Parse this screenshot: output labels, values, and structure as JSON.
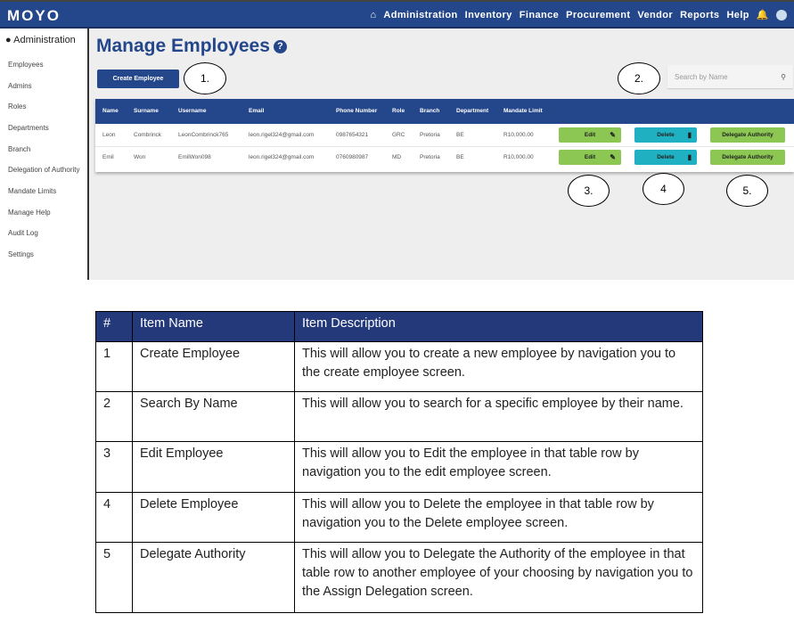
{
  "app": {
    "logo": "MOYO",
    "nav": [
      "Administration",
      "Inventory",
      "Finance",
      "Procurement",
      "Vendor",
      "Reports",
      "Help"
    ]
  },
  "sidebar": {
    "header": "Administration",
    "items": [
      "Employees",
      "Admins",
      "Roles",
      "Departments",
      "Branch",
      "Delegation of Authority",
      "Mandate Limits",
      "Manage Help",
      "Audit Log",
      "Settings"
    ]
  },
  "page": {
    "title": "Manage Employees",
    "help": "?",
    "create_label": "Create Employee",
    "search_placeholder": "Search by Name"
  },
  "callouts": [
    "1.",
    "2.",
    "3.",
    "4",
    "5."
  ],
  "employees": {
    "headers": [
      "Name",
      "Surname",
      "Username",
      "Email",
      "Phone Number",
      "Role",
      "Branch",
      "Department",
      "Mandate Limit"
    ],
    "rows": [
      [
        "Leon",
        "Combrinck",
        "LeonCombrinck765",
        "leon.rigel324@gmail.com",
        "0987654321",
        "GRC",
        "Pretoria",
        "BE",
        "R10,000.00"
      ],
      [
        "Emil",
        "Won",
        "EmilWon098",
        "leon.rigel324@gmail.com",
        "0760980987",
        "MD",
        "Pretoria",
        "BE",
        "R10,000.00"
      ]
    ],
    "edit_label": "Edit",
    "delete_label": "Delete",
    "delegate_label": "Delegate Authority"
  },
  "doc_table": {
    "headers": [
      "#",
      "Item Name",
      "Item Description"
    ],
    "rows": [
      [
        "1",
        "Create Employee",
        "This will allow you to create a new employee by navigation you to the create employee screen."
      ],
      [
        "2",
        "Search By Name",
        "This will allow you to search for a specific employee by their name."
      ],
      [
        "3",
        "Edit Employee",
        "This will allow you to Edit the employee in that table row by navigation you to the edit employee screen."
      ],
      [
        "4",
        "Delete Employee",
        "This will allow you to Delete the employee in that table row by navigation you to the Delete employee screen."
      ],
      [
        "5",
        "Delegate Authority",
        "This will allow you to Delegate the Authority of the employee in that table row to another employee of your choosing by navigation you to the Assign Delegation screen."
      ]
    ]
  }
}
